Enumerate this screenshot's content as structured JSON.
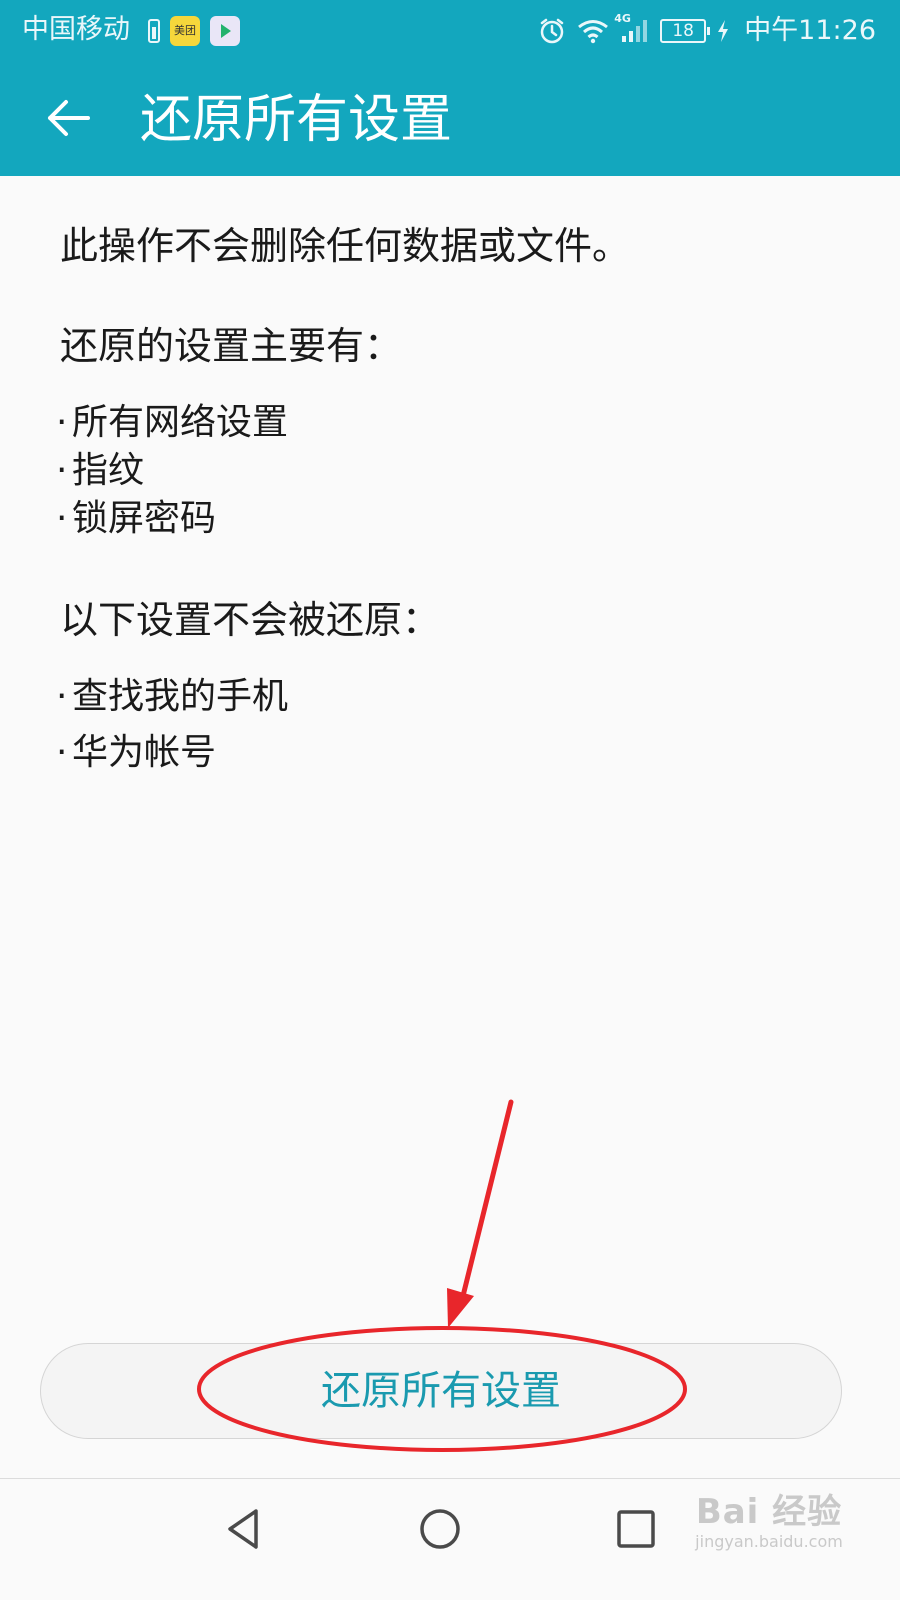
{
  "status_bar": {
    "carrier": "中国移动",
    "app_badges": [
      "美团",
      ""
    ],
    "network_label": "4G",
    "battery_level": "18",
    "time": "中午11:26"
  },
  "app_bar": {
    "title": "还原所有设置"
  },
  "content": {
    "notice": "此操作不会删除任何数据或文件。",
    "reset_heading": "还原的设置主要有：",
    "reset_items": [
      "所有网络设置",
      "指纹",
      "锁屏密码"
    ],
    "keep_heading": "以下设置不会被还原：",
    "keep_items": [
      "查找我的手机",
      "华为帐号"
    ],
    "bullet": "·"
  },
  "action": {
    "reset_button_label": "还原所有设置"
  },
  "annotation": {
    "color": "#e8262b",
    "type": "arrow-and-ellipse-highlight"
  },
  "watermark": {
    "logo": "Bai 经验",
    "url": "jingyan.baidu.com"
  },
  "colors": {
    "accent": "#13a7be",
    "button_text": "#1a9aaf",
    "background": "#fafafa"
  },
  "icons": {
    "back": "arrow-left-icon",
    "alarm": "alarm-clock-icon",
    "wifi": "wifi-icon",
    "signal": "cell-signal-icon",
    "nav_back": "triangle-back-icon",
    "nav_home": "circle-home-icon",
    "nav_recent": "square-recent-icon"
  }
}
